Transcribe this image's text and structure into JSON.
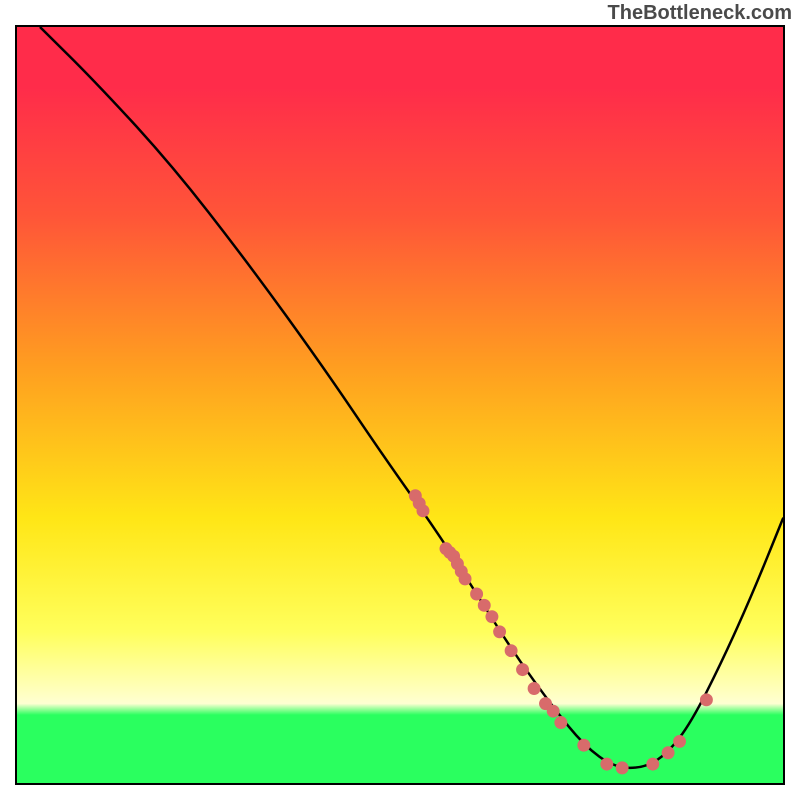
{
  "watermark": "TheBottleneck.com",
  "chart_data": {
    "type": "line",
    "title": "",
    "xlabel": "",
    "ylabel": "",
    "xlim": [
      0,
      100
    ],
    "ylim": [
      0,
      100
    ],
    "curve": [
      {
        "x": 3,
        "y": 100
      },
      {
        "x": 10,
        "y": 93
      },
      {
        "x": 20,
        "y": 82
      },
      {
        "x": 30,
        "y": 69
      },
      {
        "x": 40,
        "y": 55
      },
      {
        "x": 48,
        "y": 43
      },
      {
        "x": 55,
        "y": 33
      },
      {
        "x": 60,
        "y": 25
      },
      {
        "x": 65,
        "y": 17
      },
      {
        "x": 70,
        "y": 10
      },
      {
        "x": 74,
        "y": 5
      },
      {
        "x": 78,
        "y": 2
      },
      {
        "x": 82,
        "y": 2
      },
      {
        "x": 85,
        "y": 4
      },
      {
        "x": 88,
        "y": 8
      },
      {
        "x": 92,
        "y": 16
      },
      {
        "x": 96,
        "y": 25
      },
      {
        "x": 100,
        "y": 35
      }
    ],
    "markers": [
      {
        "x": 52,
        "y": 38
      },
      {
        "x": 52.5,
        "y": 37
      },
      {
        "x": 53,
        "y": 36
      },
      {
        "x": 56,
        "y": 31
      },
      {
        "x": 56.5,
        "y": 30.5
      },
      {
        "x": 57,
        "y": 30
      },
      {
        "x": 57.5,
        "y": 29
      },
      {
        "x": 58,
        "y": 28
      },
      {
        "x": 58.5,
        "y": 27
      },
      {
        "x": 60,
        "y": 25
      },
      {
        "x": 61,
        "y": 23.5
      },
      {
        "x": 62,
        "y": 22
      },
      {
        "x": 63,
        "y": 20
      },
      {
        "x": 64.5,
        "y": 17.5
      },
      {
        "x": 66,
        "y": 15
      },
      {
        "x": 67.5,
        "y": 12.5
      },
      {
        "x": 69,
        "y": 10.5
      },
      {
        "x": 70,
        "y": 9.5
      },
      {
        "x": 71,
        "y": 8
      },
      {
        "x": 74,
        "y": 5
      },
      {
        "x": 77,
        "y": 2.5
      },
      {
        "x": 79,
        "y": 2
      },
      {
        "x": 83,
        "y": 2.5
      },
      {
        "x": 85,
        "y": 4
      },
      {
        "x": 86.5,
        "y": 5.5
      },
      {
        "x": 90,
        "y": 11
      }
    ],
    "marker_color": "#d86b6b",
    "curve_color": "#000000"
  }
}
